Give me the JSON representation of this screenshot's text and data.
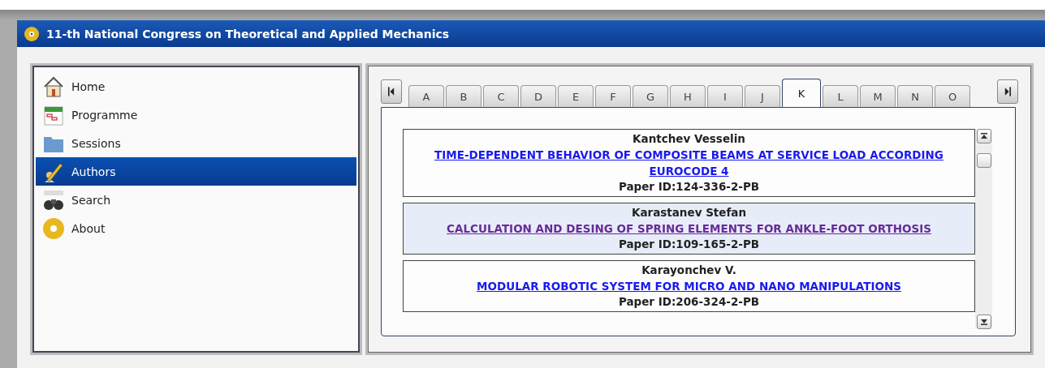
{
  "window": {
    "title": "11-th National Congress on Theoretical and Applied Mechanics"
  },
  "sidebar": {
    "items": [
      {
        "label": "Home",
        "selected": false
      },
      {
        "label": "Programme",
        "selected": false
      },
      {
        "label": "Sessions",
        "selected": false
      },
      {
        "label": "Authors",
        "selected": true
      },
      {
        "label": "Search",
        "selected": false
      },
      {
        "label": "About",
        "selected": false
      }
    ]
  },
  "tabs": [
    {
      "label": "A",
      "selected": false
    },
    {
      "label": "B",
      "selected": false
    },
    {
      "label": "C",
      "selected": false
    },
    {
      "label": "D",
      "selected": false
    },
    {
      "label": "E",
      "selected": false
    },
    {
      "label": "F",
      "selected": false
    },
    {
      "label": "G",
      "selected": false
    },
    {
      "label": "H",
      "selected": false
    },
    {
      "label": "I",
      "selected": false
    },
    {
      "label": "J",
      "selected": false
    },
    {
      "label": "K",
      "selected": true
    },
    {
      "label": "L",
      "selected": false
    },
    {
      "label": "M",
      "selected": false
    },
    {
      "label": "N",
      "selected": false
    },
    {
      "label": "O",
      "selected": false
    }
  ],
  "papers": [
    {
      "author": "Kantchev Vesselin",
      "title": "TIME-DEPENDENT BEHAVIOR OF COMPOSITE BEAMS AT SERVICE LOAD ACCORDING EUROCODE 4",
      "paper_id": "Paper ID:124-336-2-PB",
      "selected": false,
      "visited": false
    },
    {
      "author": "Karastanev Stefan",
      "title": "CALCULATION AND DESING OF SPRING ELEMENTS FOR ANKLE-FOOT ORTHOSIS",
      "paper_id": "Paper ID:109-165-2-PB",
      "selected": true,
      "visited": true
    },
    {
      "author": "Karayonchev V.",
      "title": "MODULAR ROBOTIC SYSTEM FOR MICRO AND NANO MANIPULATIONS",
      "paper_id": "Paper ID:206-324-2-PB",
      "selected": false,
      "visited": false
    }
  ]
}
